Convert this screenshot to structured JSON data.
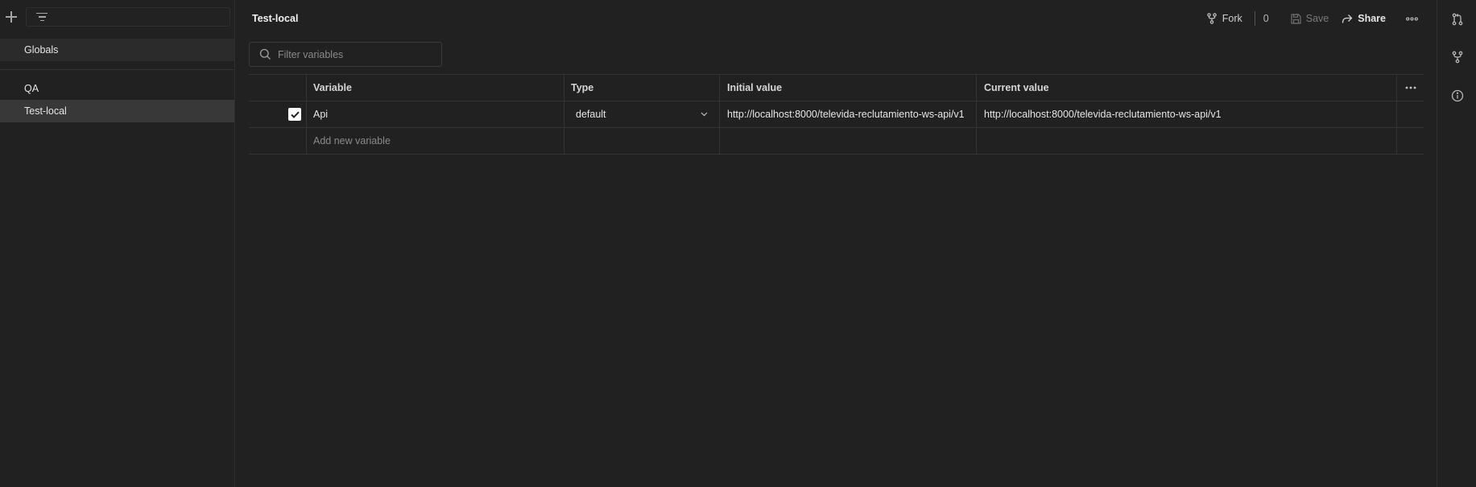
{
  "sidebar": {
    "items": [
      {
        "label": "Globals"
      },
      {
        "label": "QA"
      },
      {
        "label": "Test-local"
      }
    ]
  },
  "header": {
    "title": "Test-local",
    "fork_label": "Fork",
    "fork_count": "0",
    "save_label": "Save",
    "share_label": "Share"
  },
  "filter": {
    "placeholder": "Filter variables"
  },
  "table": {
    "columns": [
      "Variable",
      "Type",
      "Initial value",
      "Current value"
    ],
    "rows": [
      {
        "checked": true,
        "variable": "Api",
        "type": "default",
        "initial_value": "http://localhost:8000/televida-reclutamiento-ws-api/v1",
        "current_value": "http://localhost:8000/televida-reclutamiento-ws-api/v1"
      }
    ],
    "add_placeholder": "Add new variable"
  },
  "icons": {
    "sidebar_add": "plus-icon",
    "sidebar_filter": "filter-lines-icon",
    "fork": "fork-icon",
    "save": "save-disk-icon",
    "share": "share-arrow-icon",
    "more": "more-horizontal-icon",
    "search": "search-icon",
    "rail": [
      "pull-request-icon",
      "fork-icon",
      "info-icon"
    ]
  },
  "colors": {
    "background": "#212121",
    "active_item": "#383838",
    "checkbox": "#ffffff"
  }
}
